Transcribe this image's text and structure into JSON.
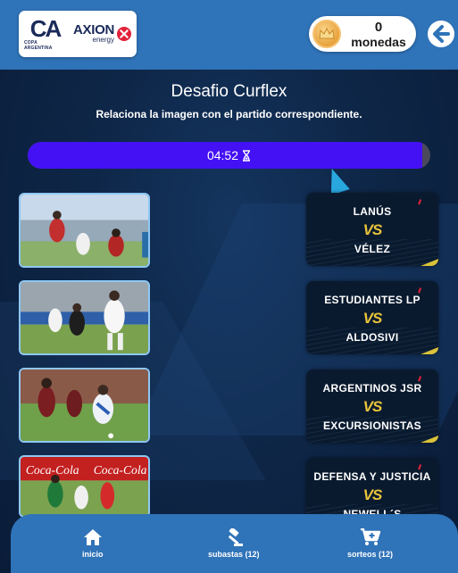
{
  "header": {
    "logo_ca": "CA",
    "logo_ca_sub": "COPA ARGENTINA",
    "logo_sponsor": "AXION",
    "logo_sponsor_sub": "energy",
    "coins_value": "0",
    "coins_label": "monedas",
    "icons": {
      "coin": "crown-coin-icon",
      "back": "arrow-left-icon"
    }
  },
  "challenge": {
    "title": "Desafio Curflex",
    "subtitle": "Relaciona la imagen con el partido correspondiente.",
    "timer_text": "04:52",
    "timer_progress": 0.98,
    "timer_icon": "hourglass-icon"
  },
  "photos": [
    {
      "name": "match-photo-1",
      "icon": "football-photo"
    },
    {
      "name": "match-photo-2",
      "icon": "football-photo"
    },
    {
      "name": "match-photo-3",
      "icon": "football-photo"
    },
    {
      "name": "match-photo-4",
      "icon": "football-photo"
    }
  ],
  "matches": [
    {
      "home": "LANÚS",
      "vs": "VS",
      "away": "VÉLEZ"
    },
    {
      "home": "ESTUDIANTES LP",
      "vs": "VS",
      "away": "ALDOSIVI"
    },
    {
      "home": "ARGENTINOS JSR",
      "vs": "VS",
      "away": "EXCURSIONISTAS"
    },
    {
      "home": "DEFENSA Y JUSTICIA",
      "vs": "VS",
      "away": "NEWELL´S"
    }
  ],
  "nav": [
    {
      "label": "inicio",
      "icon": "home-icon"
    },
    {
      "label": "subastas (12)",
      "icon": "gavel-icon"
    },
    {
      "label": "sorteos (12)",
      "icon": "cart-plus-icon"
    }
  ],
  "colors": {
    "header_bg": "#2f73b8",
    "timer_fill": "#4411f5",
    "vs_gold": "#e8c43a",
    "photo_border": "#8fc7f4"
  }
}
